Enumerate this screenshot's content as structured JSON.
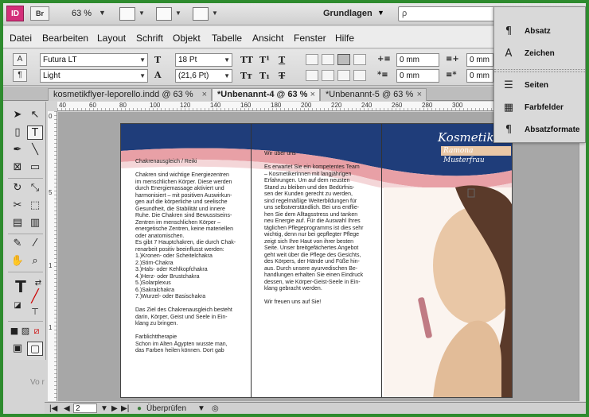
{
  "appbar": {
    "logo": "ID",
    "bridge": "Br",
    "zoom": "63 %",
    "workspace": "Grundlagen",
    "search_placeholder": "ρ"
  },
  "menu": [
    "Datei",
    "Bearbeiten",
    "Layout",
    "Schrift",
    "Objekt",
    "Tabelle",
    "Ansicht",
    "Fenster",
    "Hilfe"
  ],
  "control": {
    "font_family": "Futura LT",
    "font_style": "Light",
    "font_size": "18 Pt",
    "leading": "(21,6 Pt)",
    "indent_left": "0 mm",
    "indent_first": "0 mm",
    "indent_right": "0 mm",
    "indent_last": "0 mm"
  },
  "tabs": [
    {
      "label": "kosmetikflyer-leporello.indd @ 63 %",
      "close": "×"
    },
    {
      "label": "*Unbenannt-4 @ 63 %",
      "close": "×"
    },
    {
      "label": "*Unbenannt-5 @ 63 %",
      "close": "×"
    }
  ],
  "rulers": {
    "top": [
      "40",
      "60",
      "80",
      "100",
      "120",
      "140",
      "160",
      "180",
      "200",
      "220",
      "240",
      "260",
      "280",
      "300"
    ],
    "left": [
      "0",
      "5",
      "1",
      "1"
    ]
  },
  "document": {
    "col1": "Chakrenausgleich / Reiki\n\nChakren sind wichtige Energiezentren\nim menschlichen Körper. Diese werden\ndurch Energiemassage aktiviert und\nharmonisiert – mit positiven Auswirkun-\ngen auf die körperliche und seelische\nGesundheit, die Stabilität und innere\nRuhe. Die Chakren sind Bewusstseins-\nZentren im menschlichen Körper –\nenergetische Zentren, keine materiellen\noder anatomischen.\nEs gibt 7 Hauptchakren, die durch Chak-\nrenarbeit positiv beeinflusst werden:\n1.)Kronen- oder Scheitelchakra\n2.)Stirn-Chakra\n3.)Hals- oder Kehlkopfchakra\n4.)Herz- oder Brustchakra\n5.)Solarplexus\n6.)Sakralchakra\n7.)Wurzel- oder Basischakra\n\nDas Ziel des Chakrenausgleich besteht\ndarin, Körper, Geist und Seele in Ein-\nklang zu bringen.\n\nFarblichttherapie\nSchon im Alten Ägypten wusste man,\ndas Farben heilen können. Dort gab",
    "col2": "Wir über uns\n\nEs erwartet Sie ein kompetentes Team\n– Kosmetikerinnen mit langjährigen\nErfahrungen. Um auf dem neusten\nStand zu bleiben und den Bedürfnis-\nsen der Kunden gerecht zu werden,\nsind regelmäßige Weiterbildungen für\nuns selbstverständlich. Bei uns entflie-\nhen Sie dem Alltagsstress und tanken\nneu Energie auf. Für die Auswahl Ihres\ntäglichen Pflegeprogramms ist dies sehr\nwichtig, denn nur bei gepflegter Pflege\nzeigt sich Ihre Haut von ihrer besten\nSeite. Unser breitgefächertes Angebot\ngeht weit über die Pflege des Gesichts,\ndes Körpers, der Hände und Füße hin-\naus. Durch unsere ayurvedischen Be-\nhandlungen erhalten Sie einen Eindruck\ndessen, wie Körper-Geist-Seele in Ein-\nklang gebracht werden.\n\nWir freuen uns auf Sie!",
    "brand_title": "Kosmetikstudio",
    "brand_name": "Ramona Musterfrau"
  },
  "panel": {
    "items": [
      {
        "icon": "¶",
        "label": "Absatz"
      },
      {
        "icon": "A",
        "label": "Zeichen"
      },
      {
        "icon": "☰",
        "label": "Seiten"
      },
      {
        "icon": "▦",
        "label": "Farbfelder"
      },
      {
        "icon": "¶",
        "label": "Absatzformate"
      }
    ]
  },
  "status": {
    "page": "2",
    "preflight": "Überprüfen",
    "hint": "Vo r"
  },
  "colors": {
    "banner": "#1f3d7a",
    "swoosh": "#e8a0a6",
    "skin": "#e9c7a6",
    "accent": "#2e8b2e"
  }
}
